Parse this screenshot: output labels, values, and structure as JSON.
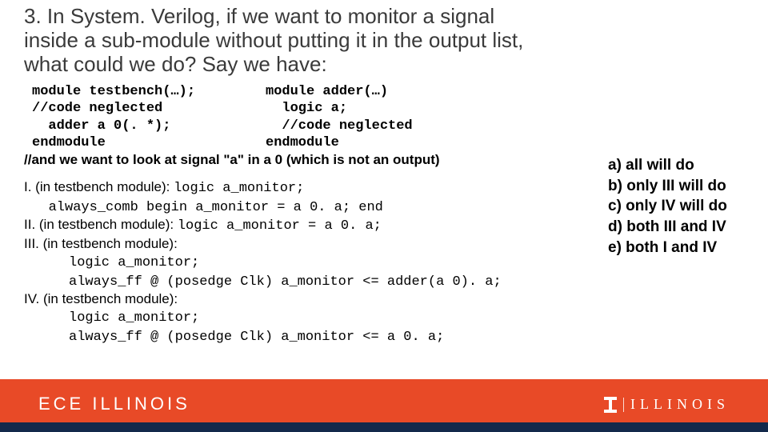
{
  "question": "3. In System. Verilog, if we want to monitor a signal inside a sub-module without putting it in the output list, what could we do? Say we have:",
  "code_left": "module testbench(…);\n//code neglected\n  adder a 0(. *);\nendmodule",
  "code_right": "module adder(…)\n  logic a;\n  //code neglected\nendmodule",
  "want_line": "//and we want to look at signal \"a\" in a 0 (which is not an output)",
  "options": {
    "i_label": "I.    (in testbench module): ",
    "i_code1": "logic a_monitor;",
    "i_code2": "always_comb begin a_monitor = a 0. a; end",
    "ii_label": "II. (in testbench module): ",
    "ii_code": "logic a_monitor = a 0. a;",
    "iii_label": "III. (in testbench module):",
    "iii_code1": "logic a_monitor;",
    "iii_code2": "always_ff @ (posedge Clk) a_monitor <= adder(a 0). a;",
    "iv_label": "IV. (in testbench module):",
    "iv_code1": "logic a_monitor;",
    "iv_code2": "always_ff @ (posedge Clk) a_monitor <= a 0. a;"
  },
  "answers": {
    "a": "a) all will do",
    "b": "b) only III will do",
    "c": "c) only IV will do",
    "d": "d) both III and IV",
    "e": "e) both I and IV"
  },
  "footer": {
    "ece": "ECE ILLINOIS",
    "ill": "ILLINOIS"
  }
}
